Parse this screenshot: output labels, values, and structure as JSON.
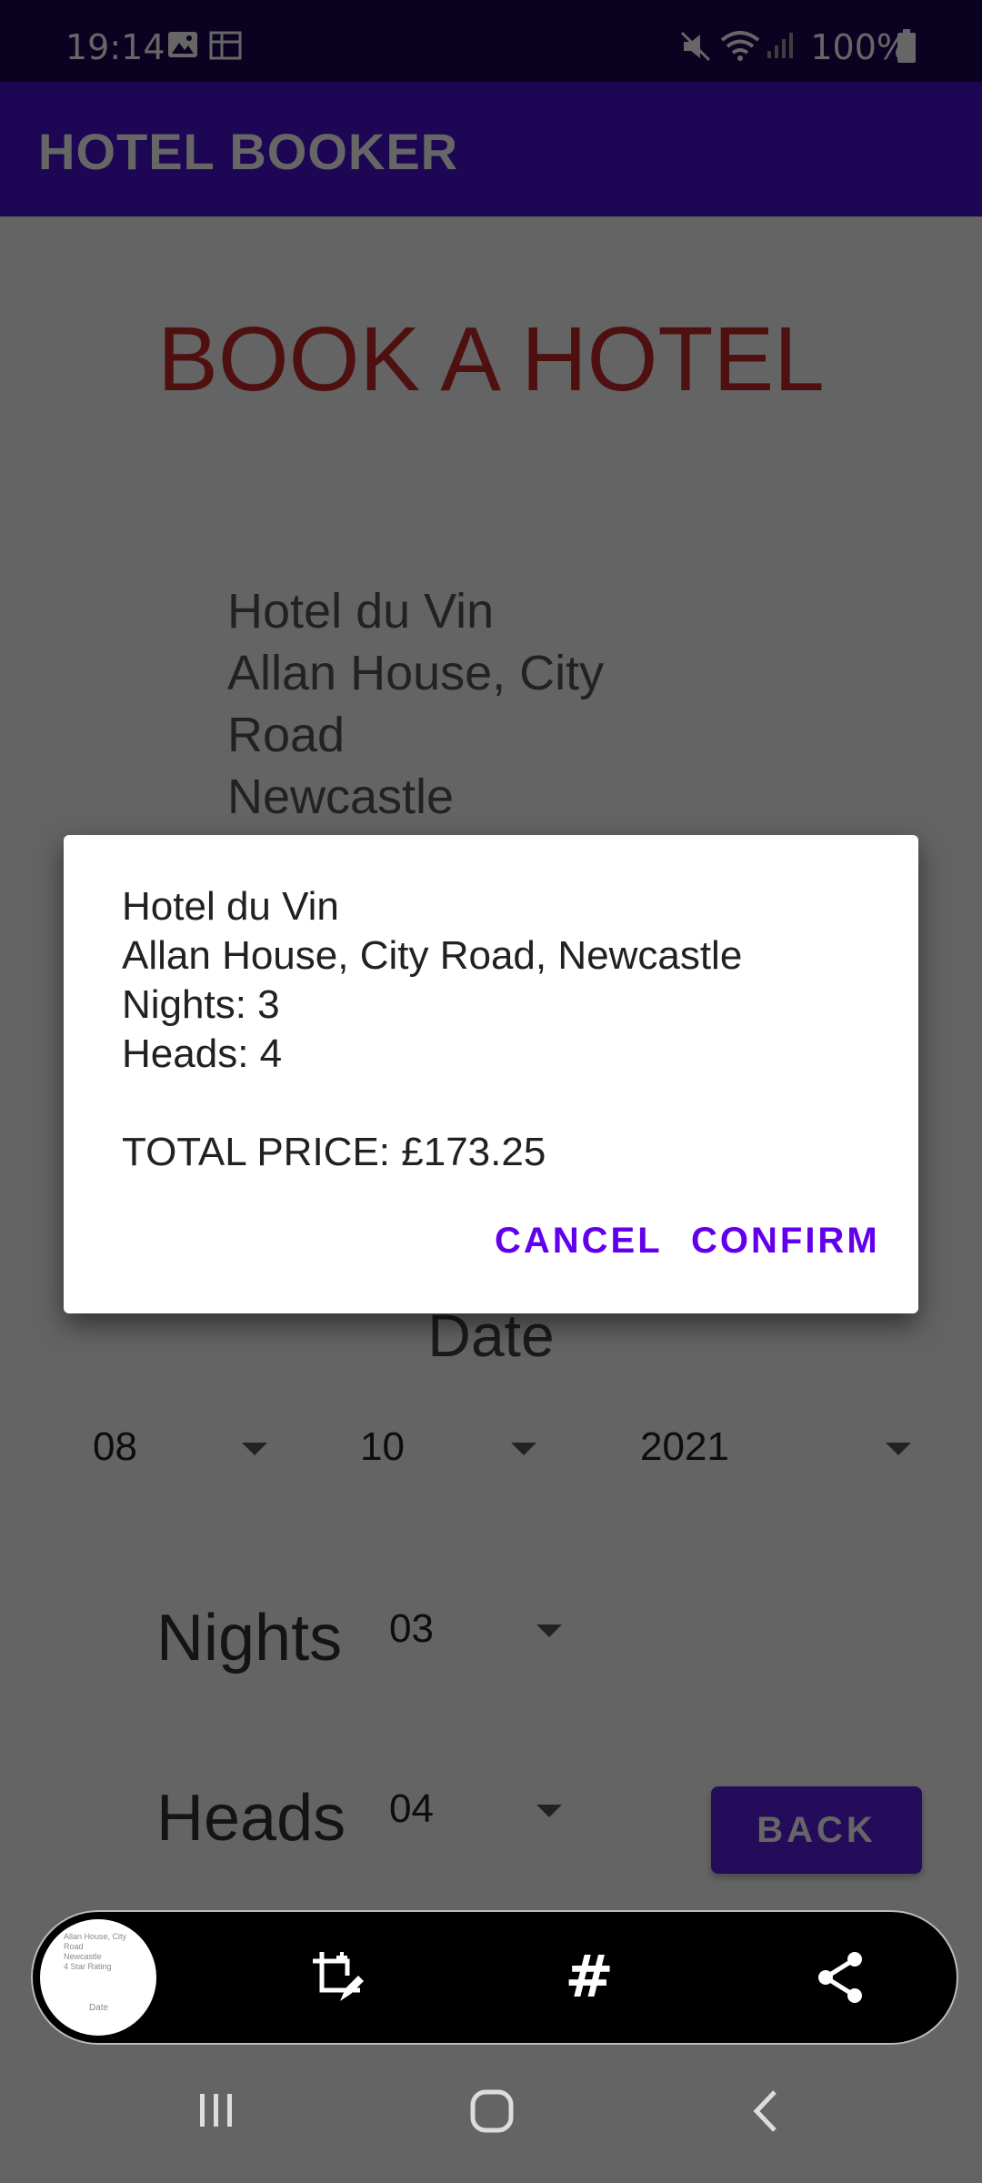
{
  "status_bar": {
    "time": "19:14",
    "battery": "100%",
    "icons": [
      "gallery-icon",
      "notification-icon",
      "mute-icon",
      "wifi-icon",
      "signal-icon",
      "battery-icon"
    ]
  },
  "app_bar": {
    "title": "HOTEL BOOKER"
  },
  "page": {
    "title": "BOOK A HOTEL",
    "hotel_lines": [
      "Hotel du Vin",
      "Allan House, City",
      "Road",
      "Newcastle"
    ],
    "date_label": "Date",
    "date": {
      "day": "08",
      "month": "10",
      "year": "2021"
    },
    "nights_label": "Nights",
    "nights_value": "03",
    "heads_label": "Heads",
    "heads_value": "04",
    "back_label": "BACK"
  },
  "dialog": {
    "hotel_name": "Hotel du Vin",
    "address": "Allan House, City Road, Newcastle",
    "nights": "Nights: 3",
    "heads": "Heads: 4",
    "total": "TOTAL PRICE: £173.25",
    "cancel_label": "CANCEL",
    "confirm_label": "CONFIRM"
  },
  "screenshot_toolbar": {
    "thumb_lines": [
      "Allan House, City",
      "Road",
      "Newcastle",
      "4 Star Rating"
    ],
    "thumb_date": "Date",
    "icons": [
      "crop-edit-icon",
      "hashtag-icon",
      "share-icon"
    ]
  },
  "colors": {
    "status_bar": "#1d0654",
    "app_bar": "#4a0fd0",
    "title_red": "#c62828",
    "accent": "#6200ee"
  }
}
